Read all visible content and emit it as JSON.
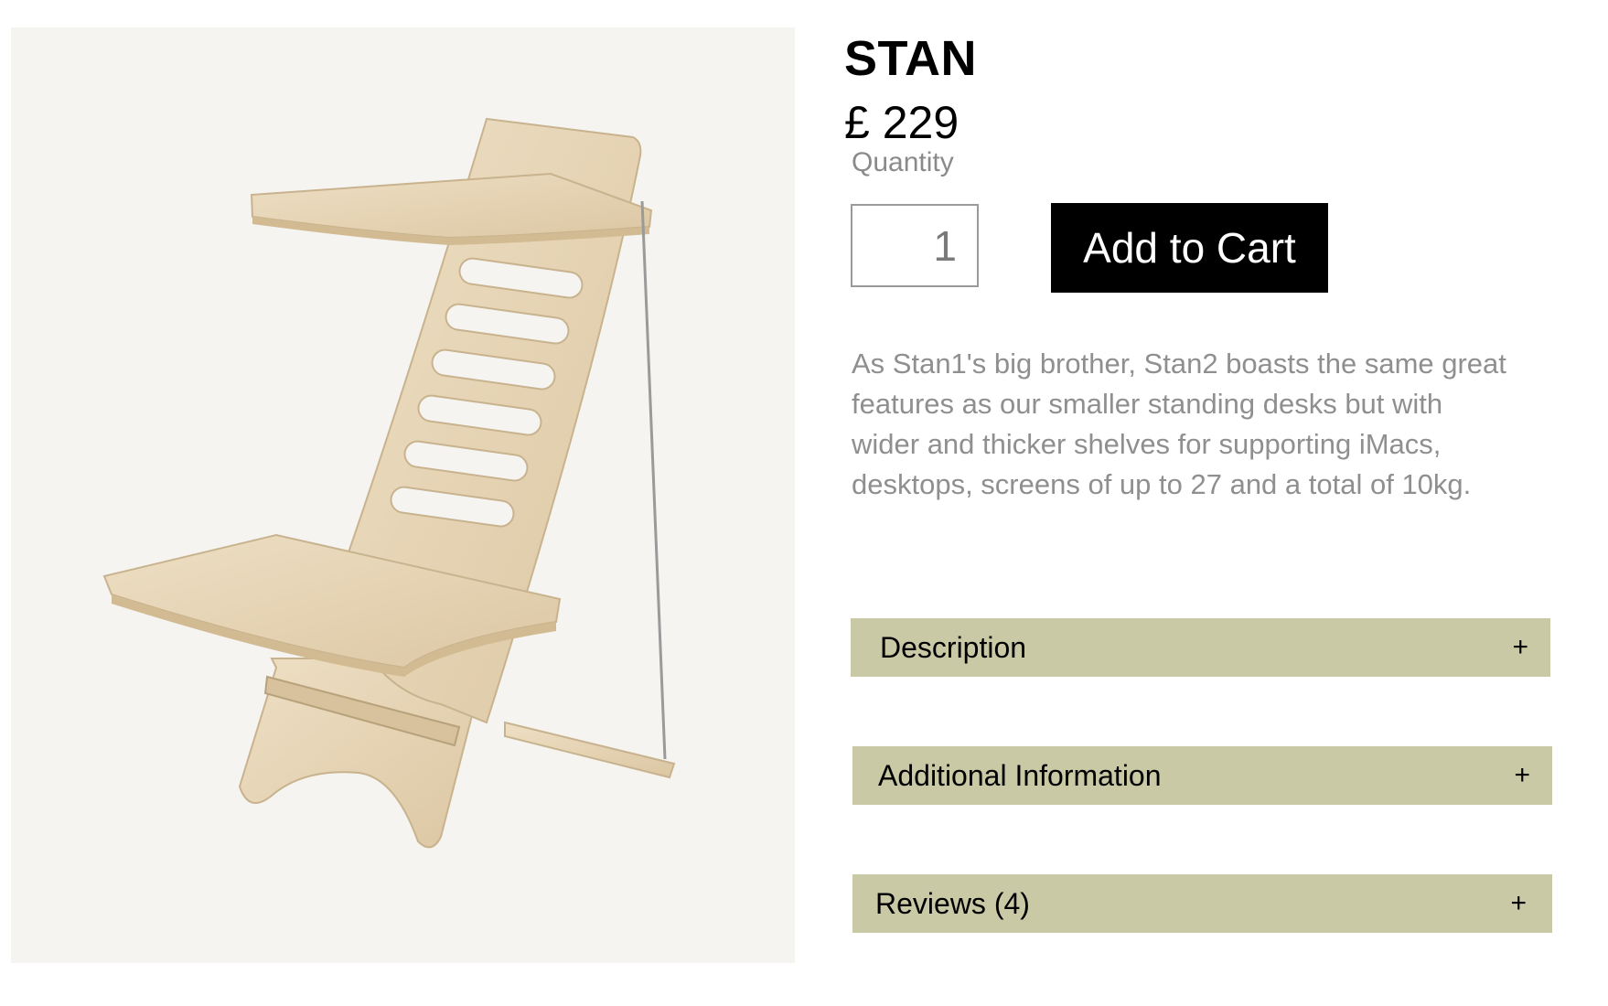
{
  "product": {
    "name": "STAN",
    "price": "£ 229",
    "quantity_label": "Quantity",
    "quantity_value": "1",
    "add_to_cart_label": "Add to Cart",
    "summary": "As Stan1's big brother, Stan2 boasts the same great features as our smaller standing desks but with wider and thicker shelves for supporting iMacs, desktops, screens of up to 27   and a total of 10kg."
  },
  "accordions": [
    {
      "label": "Description",
      "icon": "plus-icon",
      "symbol": "+"
    },
    {
      "label": "Additional Information",
      "icon": "plus-icon",
      "symbol": "+"
    },
    {
      "label": "Reviews (4)",
      "icon": "plus-icon",
      "symbol": "+"
    }
  ],
  "colors": {
    "accordion_bg": "#c9c9a5",
    "button_bg": "#000000",
    "image_bg": "#f5f4f0",
    "muted_text": "#8f8f8f"
  }
}
